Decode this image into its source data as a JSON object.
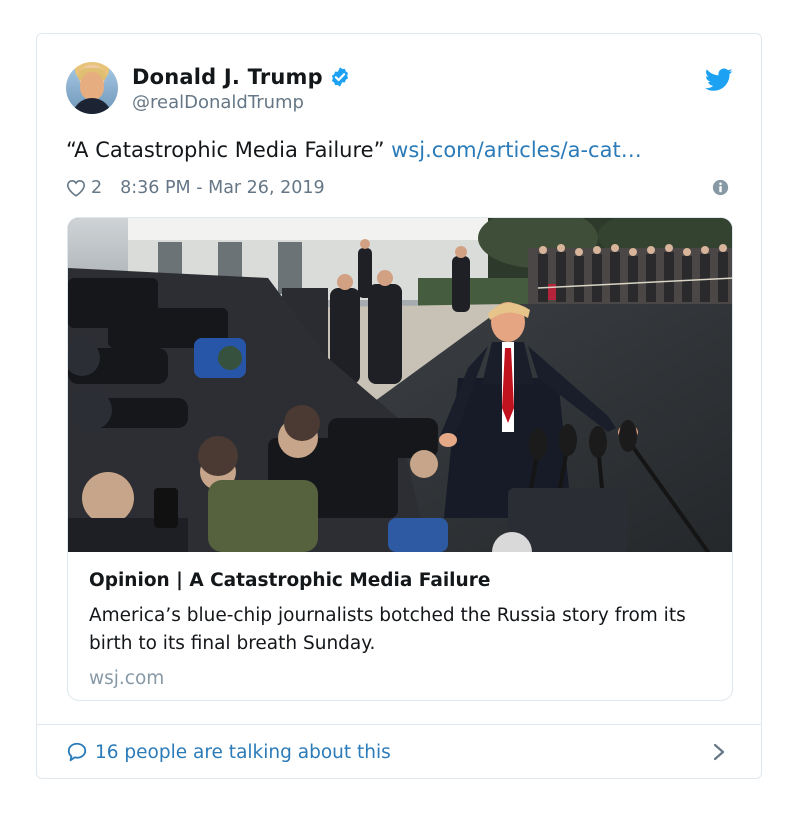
{
  "author": {
    "display_name": "Donald J. Trump",
    "handle": "@realDonaldTrump",
    "verified": true
  },
  "tweet": {
    "text": "“A Catastrophic Media Failure”",
    "link_text": "wsj.com/articles/a-cat…",
    "likes": "2",
    "timestamp": "8:36 PM - Mar 26, 2019"
  },
  "link_card": {
    "title": "Opinion | A Catastrophic Media Failure",
    "description": "America’s blue-chip journalists botched the Russia story from its birth to its final breath Sunday.",
    "domain": "wsj.com"
  },
  "footer": {
    "conversation_text": "16 people are talking about this"
  },
  "icons": {
    "verified": "verified-badge-icon",
    "brand": "twitter-bird-icon",
    "like": "heart-icon",
    "info": "info-icon",
    "reply": "speech-bubble-icon",
    "more": "chevron-right-icon"
  },
  "colors": {
    "link_blue": "#2b7bb9",
    "twitter_blue": "#1da1f2",
    "muted_gray": "#657786",
    "border": "#e1e8ed"
  }
}
